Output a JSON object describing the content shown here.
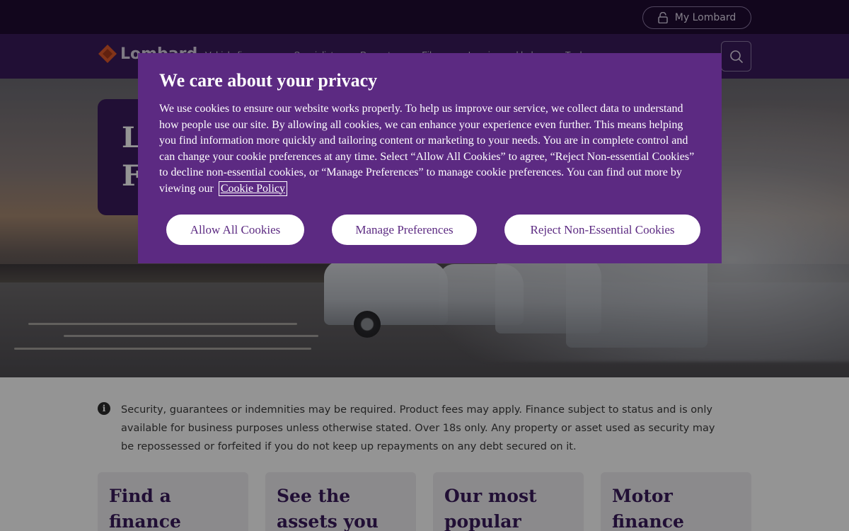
{
  "utility_bar": {
    "my_lombard_label": "My Lombard"
  },
  "main_nav": {
    "logo_text": "Lombard",
    "items": [
      {
        "label": "Vehicle finance"
      },
      {
        "label": "Specialist"
      },
      {
        "label": "Property"
      },
      {
        "label": "Files"
      },
      {
        "label": "Leasing and help"
      },
      {
        "label": "Tools"
      }
    ]
  },
  "hero": {
    "title_lines": [
      "L",
      "F"
    ]
  },
  "info": {
    "text": "Security, guarantees or indemnities may be required. Product fees may apply. Finance subject to status and is only available for business purposes unless otherwise stated. Over 18s only. Any property or asset used as security may be repossessed or forfeited if you do not keep up repayments on any debt secured on it."
  },
  "cards": [
    {
      "title": "Find a finance"
    },
    {
      "title": "See the assets you"
    },
    {
      "title": "Our most popular"
    },
    {
      "title": "Motor finance"
    }
  ],
  "cookie_banner": {
    "title": "We care about your privacy",
    "body": "We use cookies to ensure our website works properly. To help us improve our service, we collect data to understand how people use our site. By allowing all cookies, we can enhance your experience even further. This means helping you find information more quickly and tailoring content or marketing to your needs. You are in complete control and can change your cookie preferences at any time. Select “Allow All Cookies” to agree, “Reject Non-essential Cookies” to decline non-essential cookies, or “Manage Preferences” to manage cookie preferences. You can find out more by viewing our",
    "policy_link": "Cookie Policy",
    "buttons": {
      "allow_all": "Allow All Cookies",
      "manage": "Manage Preferences",
      "reject": "Reject Non-Essential Cookies"
    }
  },
  "colors": {
    "brand_purple": "#3a1a5c",
    "modal_purple": "#5c2a82",
    "logo_orange": "#e05a2b"
  },
  "icons": [
    "lock-icon",
    "search-icon",
    "info-icon",
    "lombard-logo-icon"
  ]
}
